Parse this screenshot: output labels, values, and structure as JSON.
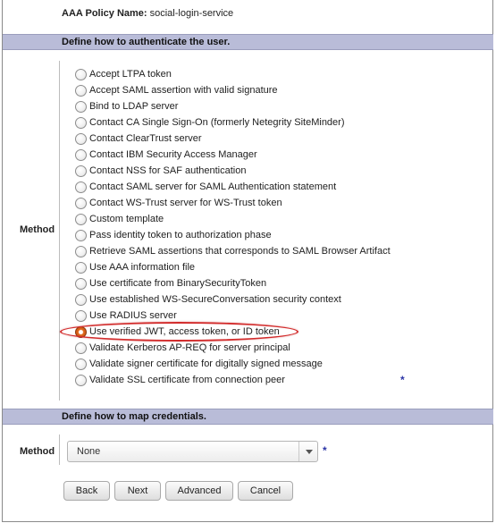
{
  "policy": {
    "label": "AAA Policy Name:",
    "value": "social-login-service"
  },
  "section_auth": {
    "title": "Define how to authenticate the user."
  },
  "method_auth": {
    "label": "Method",
    "required_mark": "*",
    "selected_index": 16,
    "options": [
      "Accept LTPA token",
      "Accept SAML assertion with valid signature",
      "Bind to LDAP server",
      "Contact CA Single Sign-On (formerly Netegrity SiteMinder)",
      "Contact ClearTrust server",
      "Contact IBM Security Access Manager",
      "Contact NSS for SAF authentication",
      "Contact SAML server for SAML Authentication statement",
      "Contact WS-Trust server for WS-Trust token",
      "Custom template",
      "Pass identity token to authorization phase",
      "Retrieve SAML assertions that corresponds to SAML Browser Artifact",
      "Use AAA information file",
      "Use certificate from BinarySecurityToken",
      "Use established WS-SecureConversation security context",
      "Use RADIUS server",
      "Use verified JWT, access token, or ID token",
      "Validate Kerberos AP-REQ for server principal",
      "Validate signer certificate for digitally signed message",
      "Validate SSL certificate from connection peer"
    ]
  },
  "section_map": {
    "title": "Define how to map credentials."
  },
  "method_map": {
    "label": "Method",
    "selected": "None",
    "required_mark": "*"
  },
  "buttons": {
    "back": "Back",
    "next": "Next",
    "advanced": "Advanced",
    "cancel": "Cancel"
  },
  "colors": {
    "section_bar": "#b9bcd8",
    "highlight": "#d22b2b",
    "selected_radio": "#e2691c",
    "required": "#2b35a6"
  }
}
